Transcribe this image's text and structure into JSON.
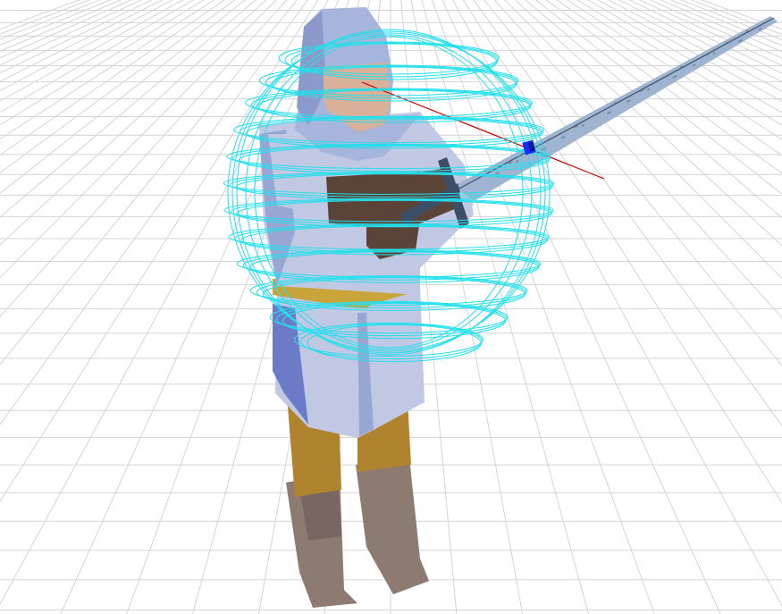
{
  "scene": {
    "background_color": "#ffffff",
    "grid_color": "#d4d4d4",
    "subject": "knight-character",
    "colors": {
      "hood": "#a7b4dc",
      "hood_shadow": "#8c9acb",
      "face": "#d9b09a",
      "tunic": "#c1c8e4",
      "tunic_shadow": "#9aa5d4",
      "sleeve_dark": "#6c7bc8",
      "gloves": "#5b4337",
      "belt": "#c9a43a",
      "legs": "#b0842e",
      "boots": "#8d7b72",
      "boots_shadow": "#776760",
      "blade": "#9fb4d0",
      "hilt": "#3d4f66",
      "gizmo_rings": "#22e0ec",
      "aim_line": "#cc0000",
      "handle_marker": "#1030ff"
    },
    "icons": [
      "gizmo-rotate-rings",
      "aim-ray",
      "pivot-handle"
    ]
  }
}
